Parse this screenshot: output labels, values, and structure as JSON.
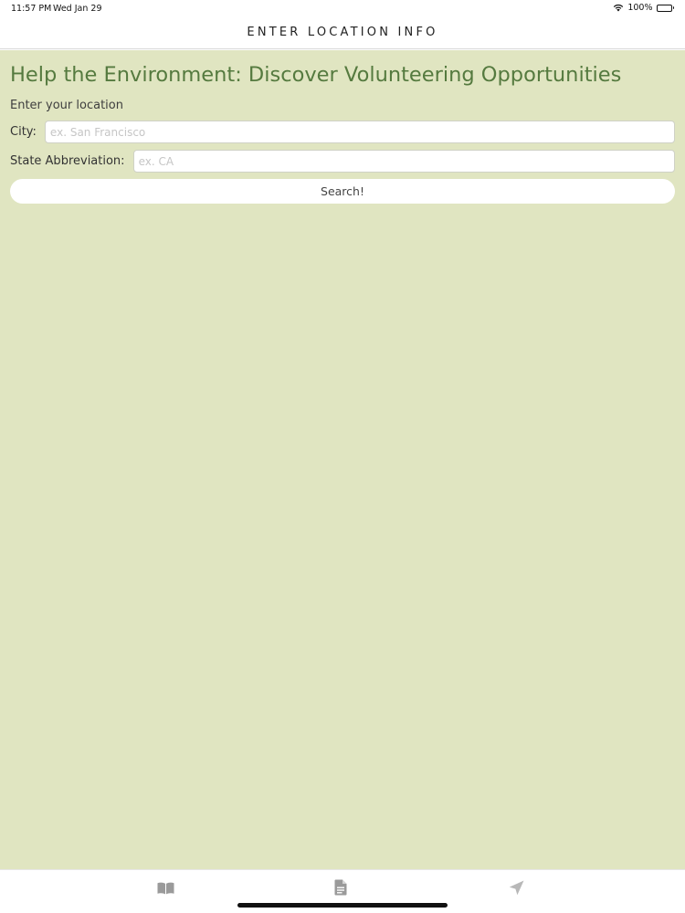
{
  "status_bar": {
    "time": "11:57 PM",
    "date": "Wed Jan 29",
    "battery": "100%"
  },
  "nav": {
    "title": "ENTER LOCATION INFO"
  },
  "main": {
    "title": "Help the Environment: Discover Volunteering Opportunities",
    "subtitle": "Enter your location",
    "city": {
      "label": "City:",
      "value": "",
      "placeholder": "ex. San Francisco"
    },
    "state": {
      "label": "State Abbreviation:",
      "value": "",
      "placeholder": "ex. CA"
    },
    "search_label": "Search!"
  },
  "tabs": [
    {
      "icon": "book-icon"
    },
    {
      "icon": "document-icon"
    },
    {
      "icon": "location-arrow-icon"
    }
  ],
  "colors": {
    "background": "#e0e5c1",
    "title": "#557a3f",
    "tab_icon": "#9a9a9a"
  }
}
